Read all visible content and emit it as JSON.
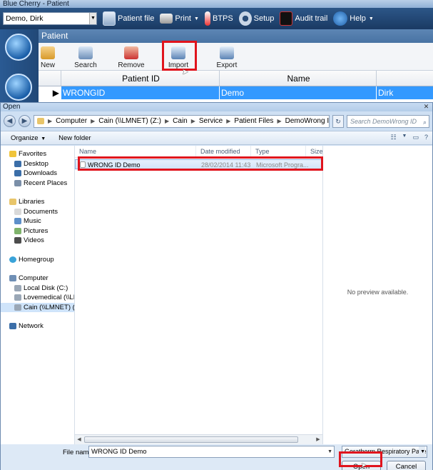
{
  "app": {
    "title": "Blue Cherry - Patient",
    "patient_select": "Demo, Dirk",
    "toolbar": {
      "patient_file": "Patient file",
      "print": "Print",
      "btps": "BTPS",
      "setup": "Setup",
      "audit_trail": "Audit trail",
      "help": "Help"
    },
    "panel_title": "Patient",
    "ribbon": {
      "new": "New",
      "search": "Search",
      "remove": "Remove",
      "import": "Import",
      "export": "Export"
    },
    "grid": {
      "columns": [
        "",
        "Patient ID",
        "Name",
        ""
      ],
      "row": {
        "marker": "▶",
        "patient_id": "WRONGID",
        "name": "Demo",
        "first": "Dirk"
      }
    },
    "side_icons": [
      "patient-icon",
      "compass-icon"
    ]
  },
  "dialog": {
    "title": "Open",
    "address": [
      "Computer",
      "Cain (\\\\LMNET) (Z:)",
      "Cain",
      "Service",
      "Patient Files",
      "DemoWrong ID"
    ],
    "search_placeholder": "Search DemoWrong ID",
    "organize": "Organize",
    "new_folder": "New folder",
    "nav": {
      "favorites": "Favorites",
      "fav_items": [
        "Desktop",
        "Downloads",
        "Recent Places"
      ],
      "libraries": "Libraries",
      "lib_items": [
        "Documents",
        "Music",
        "Pictures",
        "Videos"
      ],
      "homegroup": "Homegroup",
      "computer": "Computer",
      "comp_items": [
        "Local Disk (C:)",
        "Lovemedical (\\\\LMN",
        "Cain (\\\\LMNET) (Z:)"
      ],
      "network": "Network"
    },
    "columns": {
      "name": "Name",
      "date": "Date modified",
      "type": "Type",
      "size": "Size"
    },
    "file": {
      "name": "WRONG ID Demo",
      "date": "28/02/2014 11:43",
      "type": "Microsoft Progra..."
    },
    "preview": "No preview available.",
    "file_name_label": "File name:",
    "file_name_value": "WRONG ID Demo",
    "filter": "Geratherm Respiratory Patient (",
    "open": "Open",
    "cancel": "Cancel"
  },
  "colors": {
    "selection": "#3399ff",
    "highlight": "#e0141d",
    "app_bar": "#1a3a63"
  }
}
